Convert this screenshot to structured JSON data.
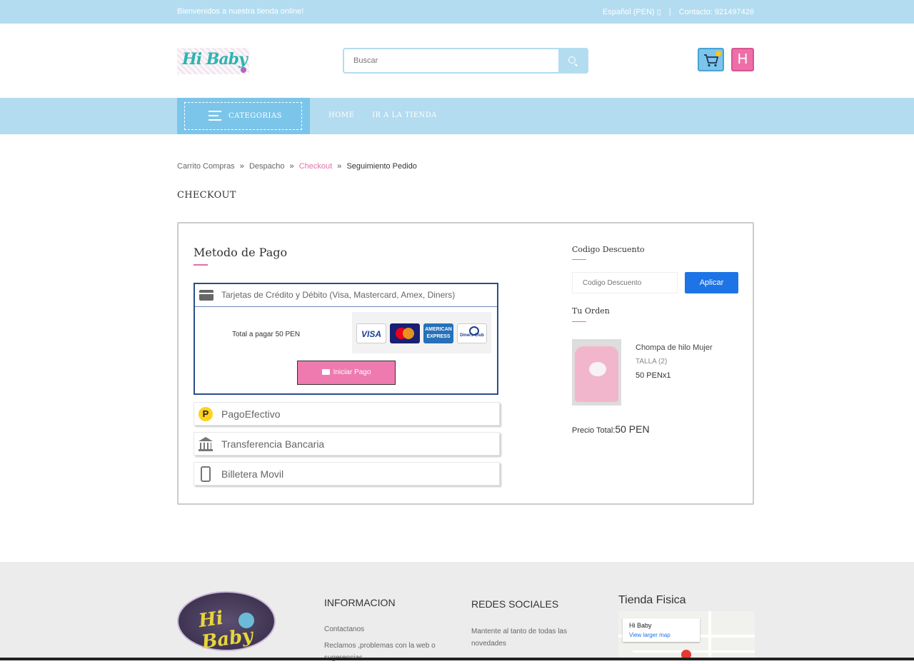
{
  "topbar": {
    "welcome": "Bienvenidos a nuestra tienda online!",
    "language": "Español (PEN)",
    "contact": "Contacto: 921497426"
  },
  "header": {
    "logo_text": "Hi Baby",
    "search_placeholder": "Buscar",
    "user_initial": "H"
  },
  "nav": {
    "categories_label": "CATEGORIAS",
    "home_label": "HOME",
    "store_label": "IR A LA TIENDA"
  },
  "breadcrumb": {
    "items": [
      "Carrito Compras",
      "Despacho",
      "Checkout",
      "Seguimiento Pedido"
    ],
    "separator": "»"
  },
  "page": {
    "title": "CHECKOUT"
  },
  "payment": {
    "title": "Metodo de Pago",
    "card_option": "Tarjetas de Crédito y Débito (Visa, Mastercard, Amex, Diners)",
    "total_text": "Total a pagar 50 PEN",
    "start_button": "Iniciar Pago",
    "brands": [
      "VISA",
      "MasterCard",
      "AMERICAN EXPRESS",
      "Diners Club"
    ],
    "other_methods": [
      {
        "label": "PagoEfectivo",
        "icon": "pagoefectivo-icon"
      },
      {
        "label": "Transferencia Bancaria",
        "icon": "bank-icon"
      },
      {
        "label": "Billetera Movil",
        "icon": "mobile-wallet-icon"
      }
    ]
  },
  "discount": {
    "title": "Codigo Descuento",
    "placeholder": "Codigo Descuento",
    "apply_label": "Aplicar"
  },
  "order": {
    "title": "Tu Orden",
    "product_name": "Chompa de hilo Mujer",
    "product_size": "TALLA (2)",
    "product_price": "50 PEN",
    "product_qty": "x1",
    "total_label": "Precio Total:",
    "total_value": "50 PEN"
  },
  "footer": {
    "info_title": "INFORMACION",
    "info_links": [
      "Contactanos",
      "Reclamos ,problemas con la web o sugerencias"
    ],
    "social_title": "REDES SOCIALES",
    "social_text": "Mantente al tanto de todas las novedades",
    "store_title": "Tienda Fisica",
    "map_place": "Hi Baby",
    "map_link": "View larger map"
  },
  "colors": {
    "light_blue": "#b3dcf0",
    "accent_blue": "#7cc5ea",
    "pink": "#e26fa9",
    "apply_blue": "#1d74e6"
  }
}
